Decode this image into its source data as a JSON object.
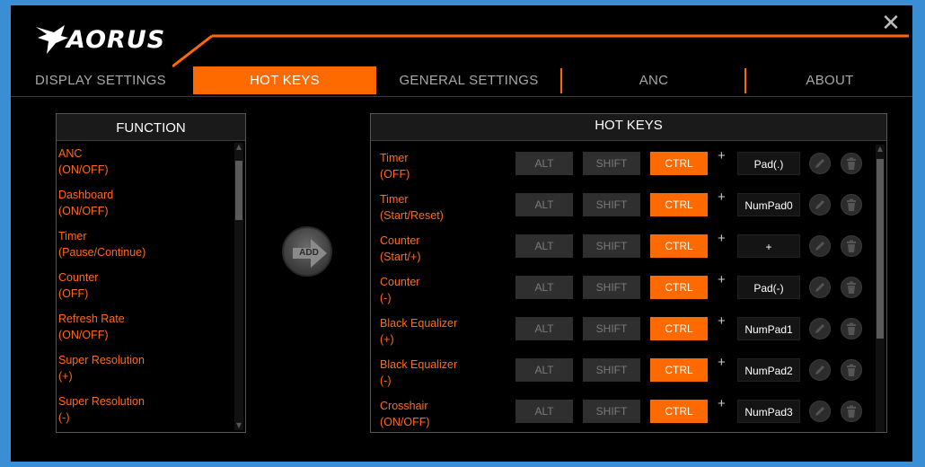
{
  "app": {
    "logo_text": "AORUS",
    "close_glyph": "✕"
  },
  "colors": {
    "accent": "#ff6a00",
    "label": "#ff6a1a",
    "background": "#000000",
    "frame": "#3a8fd4"
  },
  "tabs": [
    {
      "label": "DISPLAY SETTINGS",
      "active": false
    },
    {
      "label": "HOT KEYS",
      "active": true
    },
    {
      "label": "GENERAL SETTINGS",
      "active": false
    },
    {
      "label": "ANC",
      "active": false
    },
    {
      "label": "ABOUT",
      "active": false
    }
  ],
  "function_panel": {
    "title": "FUNCTION",
    "items": [
      {
        "line1": "ANC",
        "line2": "(ON/OFF)"
      },
      {
        "line1": "Dashboard",
        "line2": "(ON/OFF)"
      },
      {
        "line1": "Timer",
        "line2": "(Pause/Continue)"
      },
      {
        "line1": "Counter",
        "line2": "(OFF)"
      },
      {
        "line1": "Refresh Rate",
        "line2": "(ON/OFF)"
      },
      {
        "line1": "Super Resolution",
        "line2": "(+)"
      },
      {
        "line1": "Super Resolution",
        "line2": "(-)"
      }
    ]
  },
  "add_button": {
    "label": "ADD"
  },
  "hotkeys_panel": {
    "title": "HOT KEYS",
    "plus": "+",
    "modifier_labels": {
      "alt": "ALT",
      "shift": "SHIFT",
      "ctrl": "CTRL"
    },
    "rows": [
      {
        "line1": "Timer",
        "line2": "(OFF)",
        "alt": false,
        "shift": false,
        "ctrl": true,
        "key": "Pad(.)"
      },
      {
        "line1": "Timer",
        "line2": "(Start/Reset)",
        "alt": false,
        "shift": false,
        "ctrl": true,
        "key": "NumPad0"
      },
      {
        "line1": "Counter",
        "line2": "(Start/+)",
        "alt": false,
        "shift": false,
        "ctrl": true,
        "key": "+"
      },
      {
        "line1": "Counter",
        "line2": "(-)",
        "alt": false,
        "shift": false,
        "ctrl": true,
        "key": "Pad(-)"
      },
      {
        "line1": "Black Equalizer",
        "line2": "(+)",
        "alt": false,
        "shift": false,
        "ctrl": true,
        "key": "NumPad1"
      },
      {
        "line1": "Black Equalizer",
        "line2": "(-)",
        "alt": false,
        "shift": false,
        "ctrl": true,
        "key": "NumPad2"
      },
      {
        "line1": "Crosshair",
        "line2": "(ON/OFF)",
        "alt": false,
        "shift": false,
        "ctrl": true,
        "key": "NumPad3"
      }
    ]
  }
}
